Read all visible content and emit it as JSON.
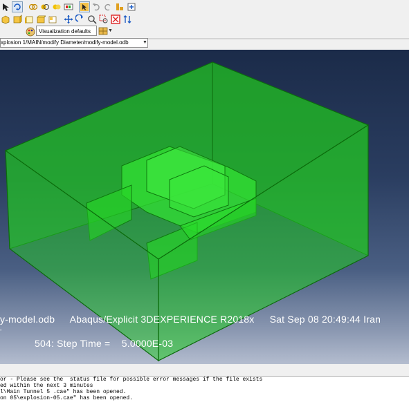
{
  "toolbar": {
    "visualization_defaults": "Visualization defaults"
  },
  "path_selector": {
    "value": "xplosion 1/MAIN/modify Diameter/modify-model.odb"
  },
  "viewport": {
    "state_block": {
      "odb_name": "y-model.odb",
      "solver": "Abaqus/Explicit 3DEXPERIENCE R2018x",
      "date": "Sat Sep 08 20:49:44 Iran"
    },
    "step_info": "504: Step Time =    5.0000E-03",
    "model_color": "#22cc22"
  },
  "messages": [
    "or - Please see the  status file for possible error messages if the file exists",
    "ed within the next 3 minutes",
    "l\\Main Tunnel 5 .cae\" has been opened.",
    "on 05\\explosion-05.cae\" has been opened."
  ],
  "colors": {
    "viewport_top": "#1b2b49",
    "viewport_bottom": "#b4bdcf",
    "model_fill": "#22cc22",
    "model_edge": "#0c6b0c"
  }
}
